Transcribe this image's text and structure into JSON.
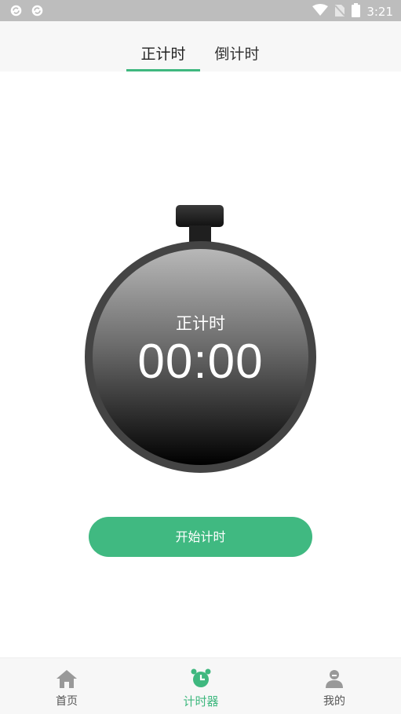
{
  "status_bar": {
    "time": "3:21"
  },
  "tabs": [
    {
      "label": "正计时",
      "active": true
    },
    {
      "label": "倒计时",
      "active": false
    }
  ],
  "stopwatch": {
    "mode_label": "正计时",
    "time": "00:00"
  },
  "start_button": {
    "label": "开始计时"
  },
  "bottom_nav": [
    {
      "label": "首页",
      "icon": "home-icon",
      "active": false
    },
    {
      "label": "计时器",
      "icon": "alarm-clock-icon",
      "active": true
    },
    {
      "label": "我的",
      "icon": "user-icon",
      "active": false
    }
  ],
  "colors": {
    "accent": "#3fb87f",
    "button": "#40b981",
    "status_bar": "#bdbdbd"
  }
}
